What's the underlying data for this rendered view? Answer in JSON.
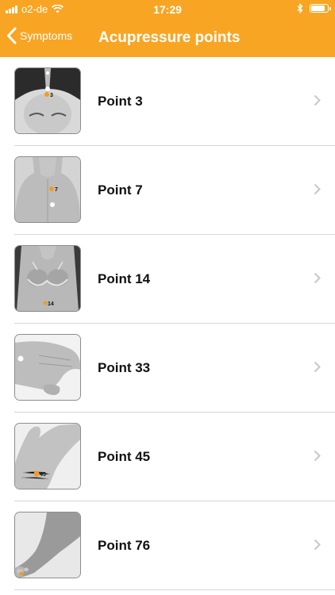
{
  "status_bar": {
    "carrier": "o2-de",
    "time": "17:29"
  },
  "nav": {
    "back_label": "Symptoms",
    "title": "Acupressure points"
  },
  "colors": {
    "header": "#f8a524",
    "marker": "#f39c1e",
    "separator": "#d6d6d6",
    "chevron": "#c7c7cc"
  },
  "points": [
    {
      "label": "Point 3",
      "marker_number": "3",
      "image": "head-top"
    },
    {
      "label": "Point 7",
      "marker_number": "7",
      "image": "upper-back"
    },
    {
      "label": "Point 14",
      "marker_number": "14",
      "image": "chest"
    },
    {
      "label": "Point 33",
      "marker_number": "",
      "image": "hand-back"
    },
    {
      "label": "Point 45",
      "marker_number": "45",
      "image": "wrist"
    },
    {
      "label": "Point 76",
      "marker_number": "",
      "image": "foot"
    }
  ]
}
